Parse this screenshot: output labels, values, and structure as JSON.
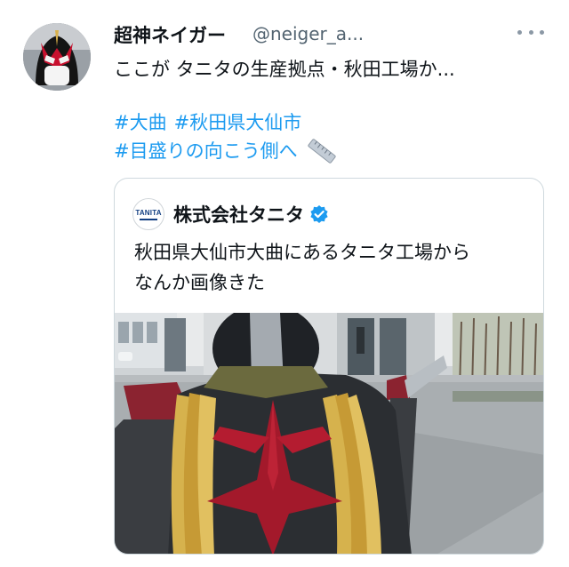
{
  "author": {
    "display_name": "超神ネイガー",
    "handle": "@neiger_a..."
  },
  "tweet": {
    "text": "ここが タニタの生産拠点・秋田工場か...",
    "hashtags": [
      "#大曲",
      "#秋田県大仙市",
      "#目盛りの向こう側へ"
    ]
  },
  "quoted_tweet": {
    "name": "株式会社タニタ",
    "logo_text": "TANITA",
    "text_lines": [
      "秋田県大仙市大曲にあるタニタ工場から",
      "なんか画像きた"
    ]
  },
  "colors": {
    "hashtag": "#1d9bf0",
    "verified": "#1d9bf0",
    "muted_text": "#536471"
  },
  "icons": [
    "more-icon",
    "ruler-icon",
    "verified-icon",
    "tanita-logo"
  ]
}
